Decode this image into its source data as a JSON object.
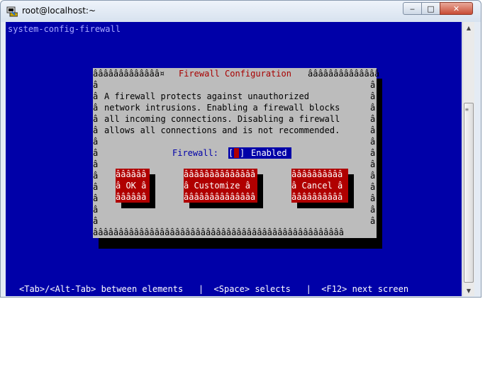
{
  "window": {
    "title": "root@localhost:~",
    "buttons": {
      "minimize": "‒",
      "maximize": "□",
      "close": "✕"
    },
    "icon": "putty-terminal-icon"
  },
  "terminal": {
    "command": "system-config-firewall",
    "background": "#0000a8",
    "dialog": {
      "title_fill": "âââââââââââââ¤",
      "title": "Firewall Configuration",
      "title_fill_right": "ââââââââââââââ",
      "border_char": "â",
      "description_lines": [
        "A firewall protects against unauthorized",
        "network intrusions. Enabling a firewall blocks",
        "all incoming connections. Disabling a firewall",
        "allows all connections and is not recommended."
      ],
      "firewall_label": "Firewall:",
      "checkbox_open": "[",
      "checkbox_close": "]",
      "firewall_state": "Enabled",
      "bottom_border": "âââââââââââââââââââââââââââââââââââââââââââââââââ",
      "buttons": [
        {
          "top": "ââââââ",
          "label": "â OK â",
          "bottom": "ââââââ"
        },
        {
          "top": "ââââââââââââââ",
          "label": "â Customize â",
          "bottom": "ââââââââââââââ"
        },
        {
          "top": "ââââââââââ",
          "label": "â Cancel â",
          "bottom": "ââââââââââ"
        }
      ]
    },
    "status_bar": "<Tab>/<Alt-Tab> between elements   |  <Space> selects   |  <F12> next screen"
  },
  "colors": {
    "dialog": "#bcbcbc",
    "button": "#b00000",
    "title_text": "#a80000",
    "status_text": "#ffffff"
  }
}
